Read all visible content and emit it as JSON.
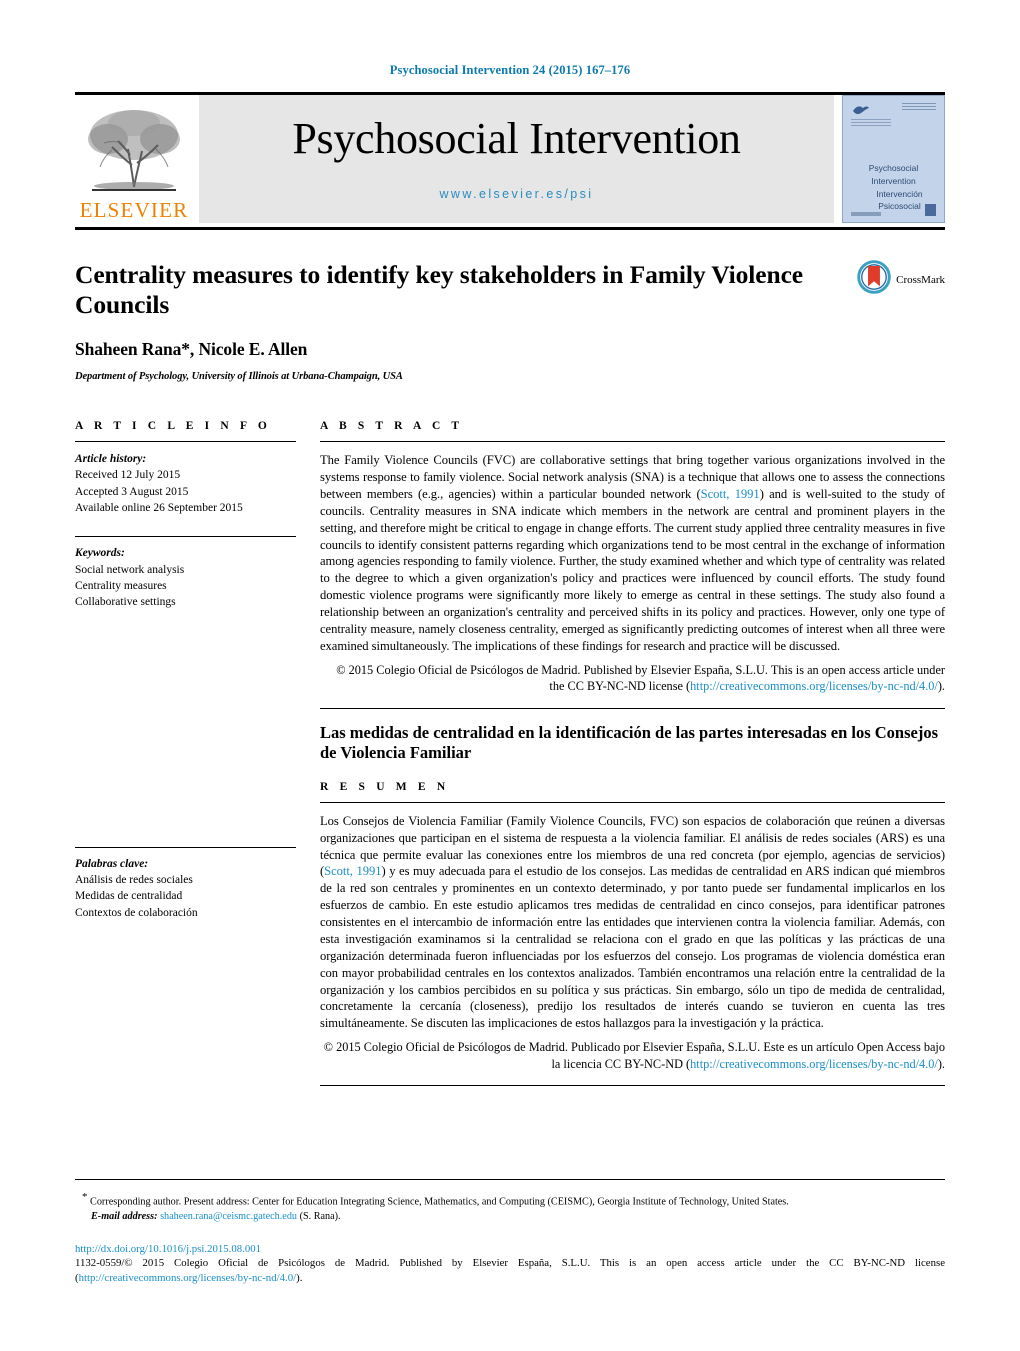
{
  "running_head": "Psychosocial Intervention 24 (2015) 167–176",
  "masthead": {
    "publisher_name": "ELSEVIER",
    "journal_title": "Psychosocial Intervention",
    "journal_url": "www.elsevier.es/psi",
    "cover": {
      "title_en": "Psychosocial Intervention",
      "title_es": "Intervención Psicosocial"
    }
  },
  "article": {
    "title": "Centrality measures to identify key stakeholders in Family Violence Councils",
    "authors": "Shaheen Rana*, Nicole E. Allen",
    "author_marker": "*",
    "affiliation": "Department of Psychology, University of Illinois at Urbana-Champaign, USA",
    "crossmark_label": "CrossMark"
  },
  "info": {
    "heading": "A R T I C L E   I N F O",
    "history_label": "Article history:",
    "history": [
      "Received 12 July 2015",
      "Accepted 3 August 2015",
      "Available online 26 September 2015"
    ],
    "keywords_label": "Keywords:",
    "keywords": [
      "Social network analysis",
      "Centrality measures",
      "Collaborative settings"
    ],
    "keywords_es_label": "Palabras clave:",
    "keywords_es": [
      "Análisis de redes sociales",
      "Medidas de centralidad",
      "Contextos de colaboración"
    ]
  },
  "abstract_en": {
    "heading": "A B S T R A C T",
    "part1": "The Family Violence Councils (FVC) are collaborative settings that bring together various organizations involved in the systems response to family violence. Social network analysis (SNA) is a technique that allows one to assess the connections between members (e.g., agencies) within a particular bounded network (",
    "citation": "Scott, 1991",
    "part2": ") and is well-suited to the study of councils. Centrality measures in SNA indicate which members in the network are central and prominent players in the setting, and therefore might be critical to engage in change efforts. The current study applied three centrality measures in five councils to identify consistent patterns regarding which organizations tend to be most central in the exchange of information among agencies responding to family violence. Further, the study examined whether and which type of centrality was related to the degree to which a given organization's policy and practices were influenced by council efforts. The study found domestic violence programs were significantly more likely to emerge as central in these settings. The study also found a relationship between an organization's centrality and perceived shifts in its policy and practices. However, only one type of centrality measure, namely closeness centrality, emerged as significantly predicting outcomes of interest when all three were examined simultaneously. The implications of these findings for research and practice will be discussed.",
    "copyright_part1": "© 2015 Colegio Oficial de Psicólogos de Madrid. Published by Elsevier España, S.L.U. This is an open access article under the CC BY-NC-ND license (",
    "copyright_link": "http://creativecommons.org/licenses/by-nc-nd/4.0/",
    "copyright_part2": ")."
  },
  "abstract_es": {
    "title": "Las medidas de centralidad en la identificación de las partes interesadas en los Consejos de Violencia Familiar",
    "heading": "R E S U M E N",
    "part1": "Los Consejos de Violencia Familiar (Family Violence Councils, FVC) son espacios de colaboración que reúnen a diversas organizaciones que participan en el sistema de respuesta a la violencia familiar. El análisis de redes sociales (ARS) es una técnica que permite evaluar las conexiones entre los miembros de una red concreta (por ejemplo, agencias de servicios) (",
    "citation": "Scott, 1991",
    "part2": ") y es muy adecuada para el estudio de los consejos. Las medidas de centralidad en ARS indican qué miembros de la red son centrales y prominentes en un contexto determinado, y por tanto puede ser fundamental implicarlos en los esfuerzos de cambio. En este estudio aplicamos tres medidas de centralidad en cinco consejos, para identificar patrones consistentes en el intercambio de información entre las entidades que intervienen contra la violencia familiar. Además, con esta investigación examinamos si la centralidad se relaciona con el grado en que las políticas y las prácticas de una organización determinada fueron influenciadas por los esfuerzos del consejo. Los programas de violencia doméstica eran con mayor probabilidad centrales en los contextos analizados. También encontramos una relación entre la centralidad de la organización y los cambios percibidos en su política y sus prácticas. Sin embargo, sólo un tipo de medida de centralidad, concretamente la cercanía (closeness), predijo los resultados de interés cuando se tuvieron en cuenta las tres simultáneamente. Se discuten las implicaciones de estos hallazgos para la investigación y la práctica.",
    "copyright_part1": "© 2015 Colegio Oficial de Psicólogos de Madrid. Publicado por Elsevier España, S.L.U. Este es un artículo Open Access bajo la licencia CC BY-NC-ND (",
    "copyright_link": "http://creativecommons.org/licenses/by-nc-nd/4.0/",
    "copyright_part2": ")."
  },
  "footer": {
    "corresponding_marker": "*",
    "corresponding_text": "Corresponding author. Present address: Center for Education Integrating Science, Mathematics, and Computing (CEISMC), Georgia Institute of Technology, United States.",
    "email_label": "E-mail address:",
    "email": "shaheen.rana@ceismc.gatech.edu",
    "email_suffix": "(S. Rana).",
    "doi": "http://dx.doi.org/10.1016/j.psi.2015.08.001",
    "issn_part1": "1132-0559/© 2015 Colegio Oficial de Psicólogos de Madrid. Published by Elsevier España, S.L.U. This is an open access article under the CC BY-NC-ND license (",
    "issn_link": "http://creativecommons.org/licenses/by-nc-nd/4.0/",
    "issn_part2": ")."
  },
  "colors": {
    "link": "#1a8ec9",
    "running_head": "#0b7ab0",
    "elsevier_orange": "#f08000",
    "banner_bg": "#e6e6e6",
    "cover_bg": "#c3d4ea"
  }
}
